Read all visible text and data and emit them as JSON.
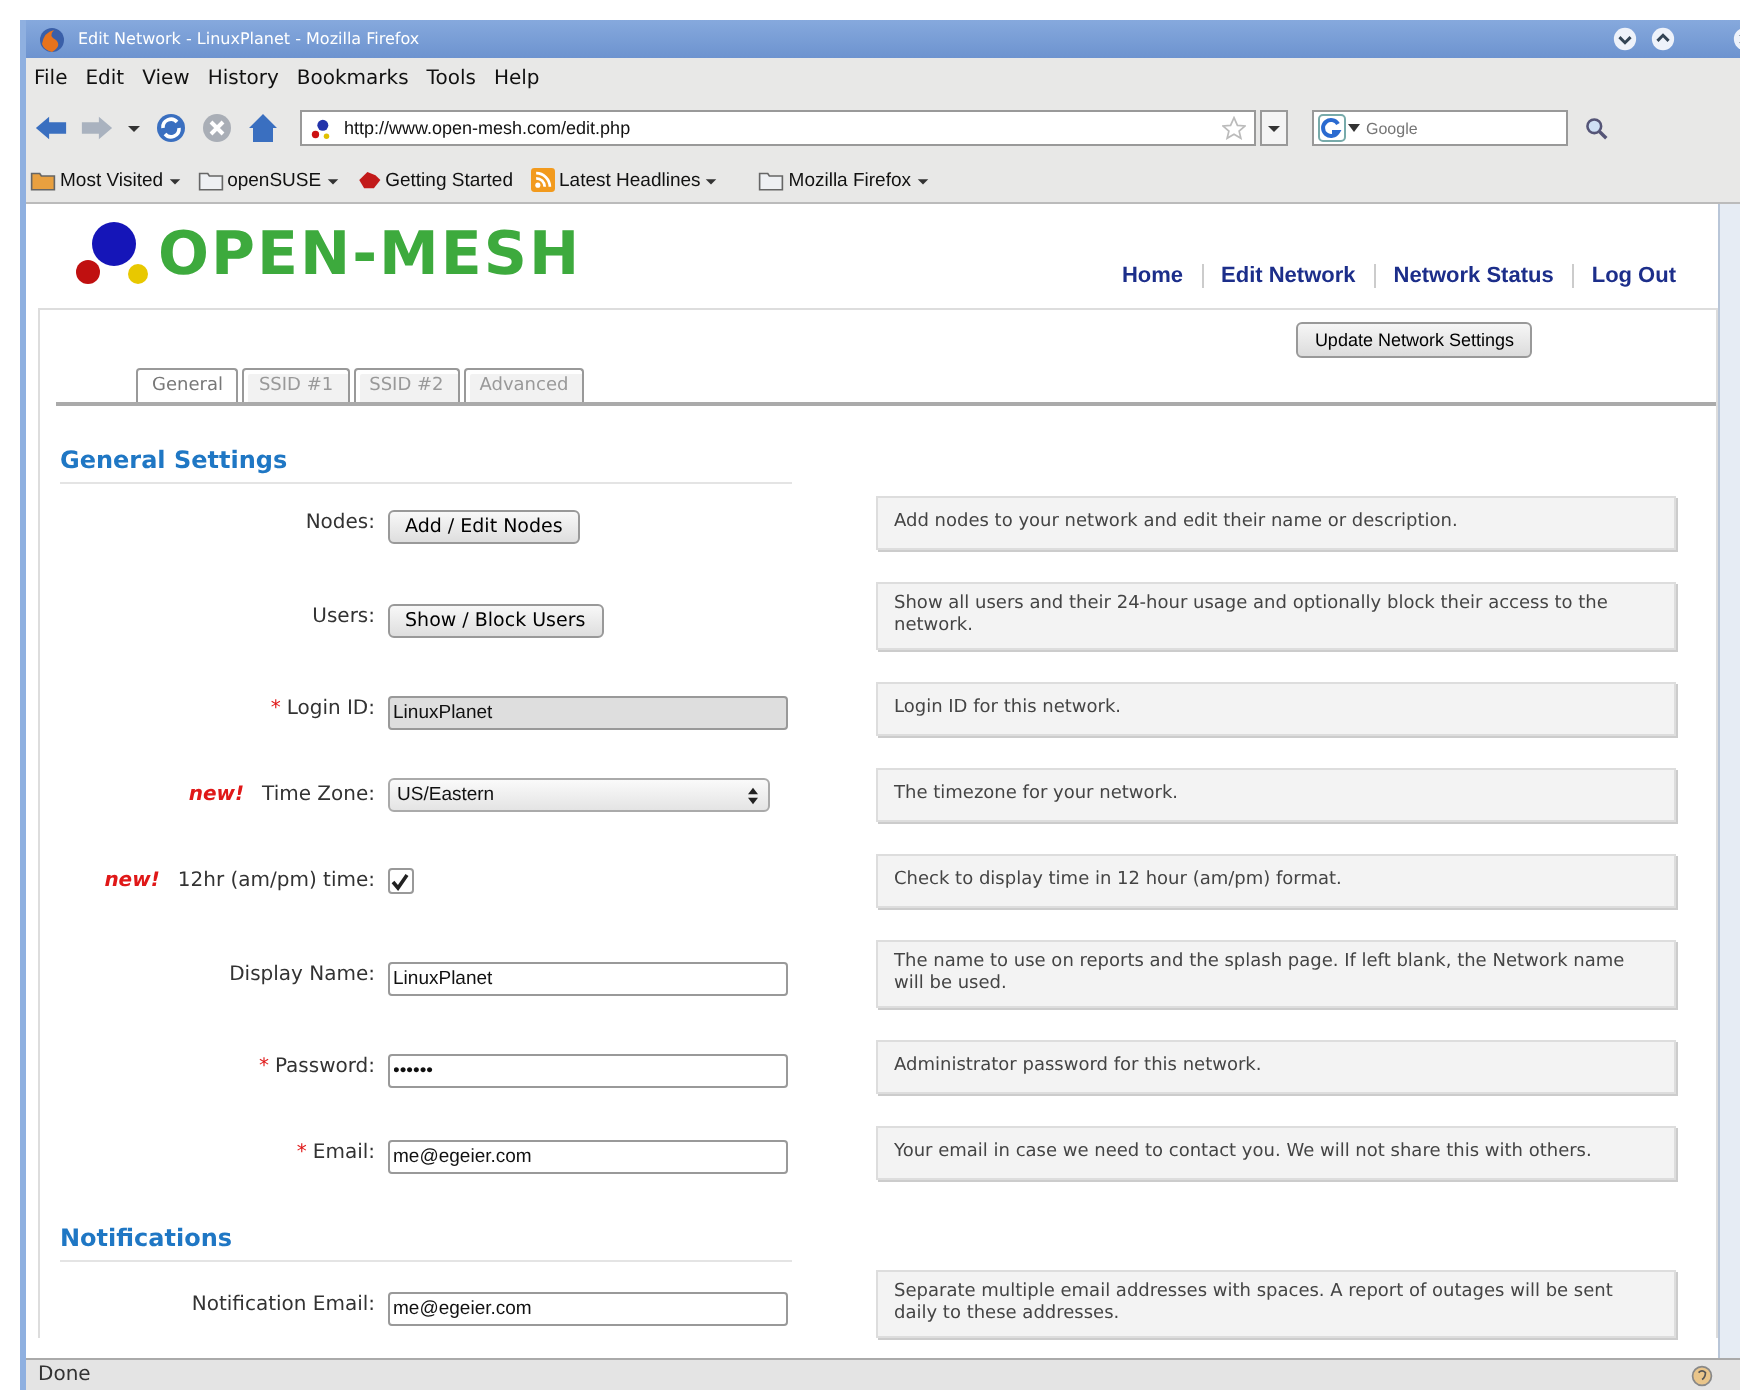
{
  "window": {
    "title": "Edit Network - LinuxPlanet - Mozilla Firefox"
  },
  "menu": [
    "File",
    "Edit",
    "View",
    "History",
    "Bookmarks",
    "Tools",
    "Help"
  ],
  "address_bar": {
    "value": "http://www.open-mesh.com/edit.php"
  },
  "search": {
    "placeholder": "Google"
  },
  "bookmarks": [
    {
      "label": "Most Visited",
      "kind": "folder",
      "dropdown": true
    },
    {
      "label": "openSUSE",
      "kind": "folder",
      "dropdown": true
    },
    {
      "label": "Getting Started",
      "kind": "page",
      "dropdown": false
    },
    {
      "label": "Latest Headlines",
      "kind": "feed",
      "dropdown": true
    },
    {
      "label": "Mozilla Firefox",
      "kind": "folder",
      "dropdown": true
    }
  ],
  "site": {
    "logo": "OPEN-MESH",
    "nav": [
      "Home",
      "Edit Network",
      "Network Status",
      "Log Out"
    ]
  },
  "update_button": "Update Network Settings",
  "tabs": [
    {
      "label": "General",
      "selected": true
    },
    {
      "label": "SSID #1",
      "selected": false
    },
    {
      "label": "SSID #2",
      "selected": false
    },
    {
      "label": "Advanced",
      "selected": false
    }
  ],
  "sections": [
    {
      "title": "General Settings",
      "rows": [
        {
          "kind": "button",
          "label": "Nodes:",
          "button": "Add / Edit Nodes",
          "help": "Add nodes to your network and edit their name or description."
        },
        {
          "kind": "button",
          "label": "Users:",
          "button": "Show / Block Users",
          "help": "Show all users and their 24-hour usage and optionally block their access to the network."
        },
        {
          "kind": "text",
          "required": "*",
          "label": "Login ID:",
          "value": "LinuxPlanet",
          "disabled": true,
          "help": "Login ID for this network."
        },
        {
          "kind": "select",
          "new": "new!",
          "label": "Time Zone:",
          "value": "US/Eastern",
          "help": "The timezone for your network."
        },
        {
          "kind": "checkbox",
          "new": "new!",
          "label": "12hr (am/pm) time:",
          "checked": true,
          "help": "Check to display time in 12 hour (am/pm) format."
        },
        {
          "kind": "text",
          "label": "Display Name:",
          "value": "LinuxPlanet",
          "disabled": false,
          "help": "The name to use on reports and the splash page. If left blank, the Network name will be used."
        },
        {
          "kind": "text",
          "required": "*",
          "label": "Password:",
          "value": "••••••",
          "disabled": false,
          "help": "Administrator password for this network."
        },
        {
          "kind": "text",
          "required": "*",
          "label": "Email:",
          "value": "me@egeier.com",
          "disabled": false,
          "help": "Your email in case we need to contact you. We will not share this with others."
        }
      ]
    },
    {
      "title": "Notifications",
      "rows": [
        {
          "kind": "text",
          "label": "Notification Email:",
          "value": "me@egeier.com",
          "disabled": false,
          "help": "Separate multiple email addresses with spaces. A report of outages will be sent daily to these addresses."
        }
      ]
    }
  ],
  "status_bar": {
    "text": "Done"
  }
}
